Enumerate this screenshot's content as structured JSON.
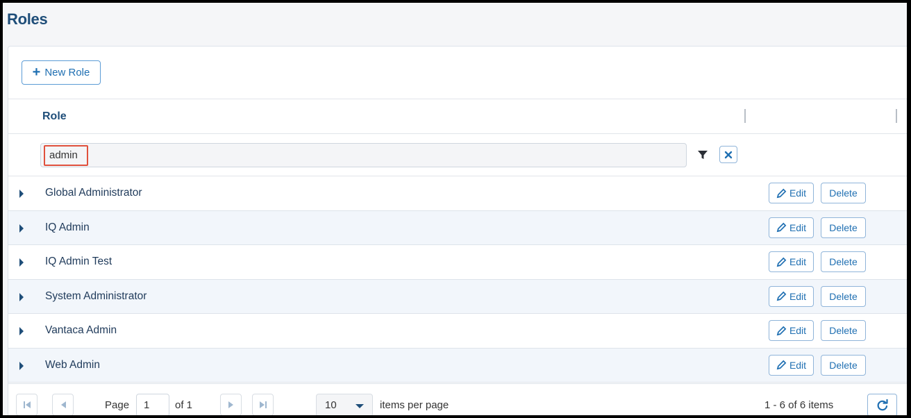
{
  "page": {
    "title": "Roles"
  },
  "toolbar": {
    "new_role_icon": "+",
    "new_role_label": "New Role"
  },
  "grid": {
    "column_header": "Role",
    "filter": {
      "value": "admin"
    },
    "rows": [
      {
        "name": "Global Administrator",
        "edit_label": "Edit",
        "delete_label": "Delete"
      },
      {
        "name": "IQ Admin",
        "edit_label": "Edit",
        "delete_label": "Delete"
      },
      {
        "name": "IQ Admin Test",
        "edit_label": "Edit",
        "delete_label": "Delete"
      },
      {
        "name": "System Administrator",
        "edit_label": "Edit",
        "delete_label": "Delete"
      },
      {
        "name": "Vantaca Admin",
        "edit_label": "Edit",
        "delete_label": "Delete"
      },
      {
        "name": "Web Admin",
        "edit_label": "Edit",
        "delete_label": "Delete"
      }
    ]
  },
  "pager": {
    "page_label": "Page",
    "current_page": "1",
    "of_label": "of 1",
    "page_size": "10",
    "items_per_page_label": "items per page",
    "summary": "1 - 6 of 6 items"
  },
  "colors": {
    "accent": "#1f6fb2",
    "title": "#1f4e79",
    "highlight": "#e0503c",
    "row_alt": "#f2f6fb"
  },
  "icons": [
    "plus-icon",
    "filter-icon",
    "close-icon",
    "caret-right-icon",
    "pencil-icon",
    "first-page-icon",
    "prev-page-icon",
    "next-page-icon",
    "last-page-icon",
    "chevron-down-icon",
    "refresh-icon"
  ]
}
